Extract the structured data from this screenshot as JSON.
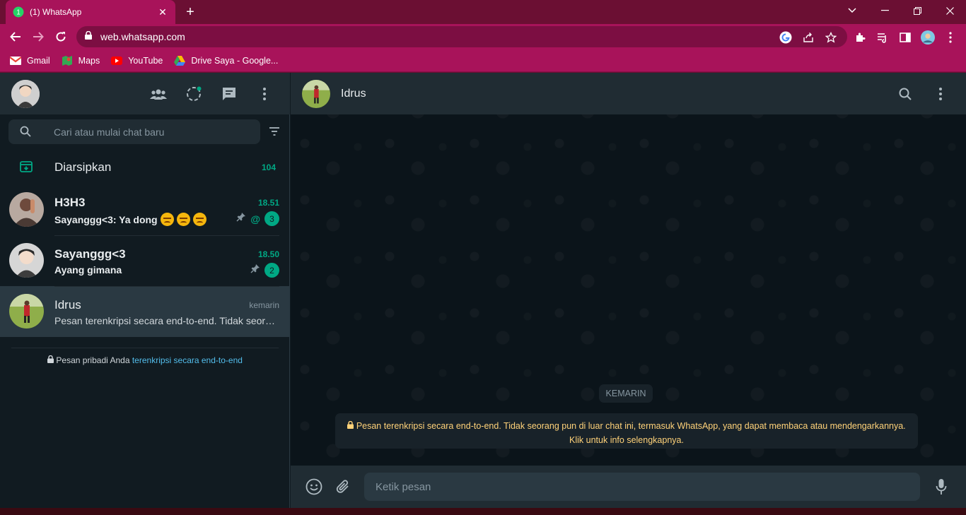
{
  "browser": {
    "tab_title": "(1) WhatsApp",
    "url": "web.whatsapp.com",
    "bookmarks": [
      {
        "label": "Gmail",
        "icon": "gmail-icon"
      },
      {
        "label": "Maps",
        "icon": "maps-icon"
      },
      {
        "label": "YouTube",
        "icon": "youtube-icon"
      },
      {
        "label": "Drive Saya - Google...",
        "icon": "drive-icon"
      }
    ]
  },
  "sidebar": {
    "search_placeholder": "Cari atau mulai chat baru",
    "archived": {
      "label": "Diarsipkan",
      "count": "104"
    },
    "chats": [
      {
        "name": "H3H3",
        "time": "18.51",
        "message": "Sayanggg<3: Ya dong",
        "unread": "3",
        "mention": "@",
        "pinned": true,
        "emoji_count": 3
      },
      {
        "name": "Sayanggg<3",
        "time": "18.50",
        "message": "Ayang gimana",
        "unread": "2",
        "pinned": true
      },
      {
        "name": "Idrus",
        "time": "kemarin",
        "message": "Pesan terenkripsi secara end-to-end. Tidak seorang pun di luar chat ini, termasuk WhatsApp, yang dapat membaca atau mendengarkannya."
      }
    ],
    "footer_text": "Pesan pribadi Anda",
    "footer_link": "terenkripsi secara end-to-end"
  },
  "conversation": {
    "contact_name": "Idrus",
    "day_label": "KEMARIN",
    "e2e_line1": "Pesan terenkripsi secara end-to-end. Tidak seorang pun di luar chat ini, termasuk WhatsApp, yang dapat membaca atau mendengarkannya.",
    "e2e_line2": "Klik untuk info selengkapnya.",
    "input_placeholder": "Ketik pesan"
  },
  "colors": {
    "accent": "#00a884",
    "chrome_frame": "#6b0f33",
    "chrome_toolbar": "#a8135a",
    "e2e_text": "#ffd279",
    "link": "#53bdeb"
  }
}
